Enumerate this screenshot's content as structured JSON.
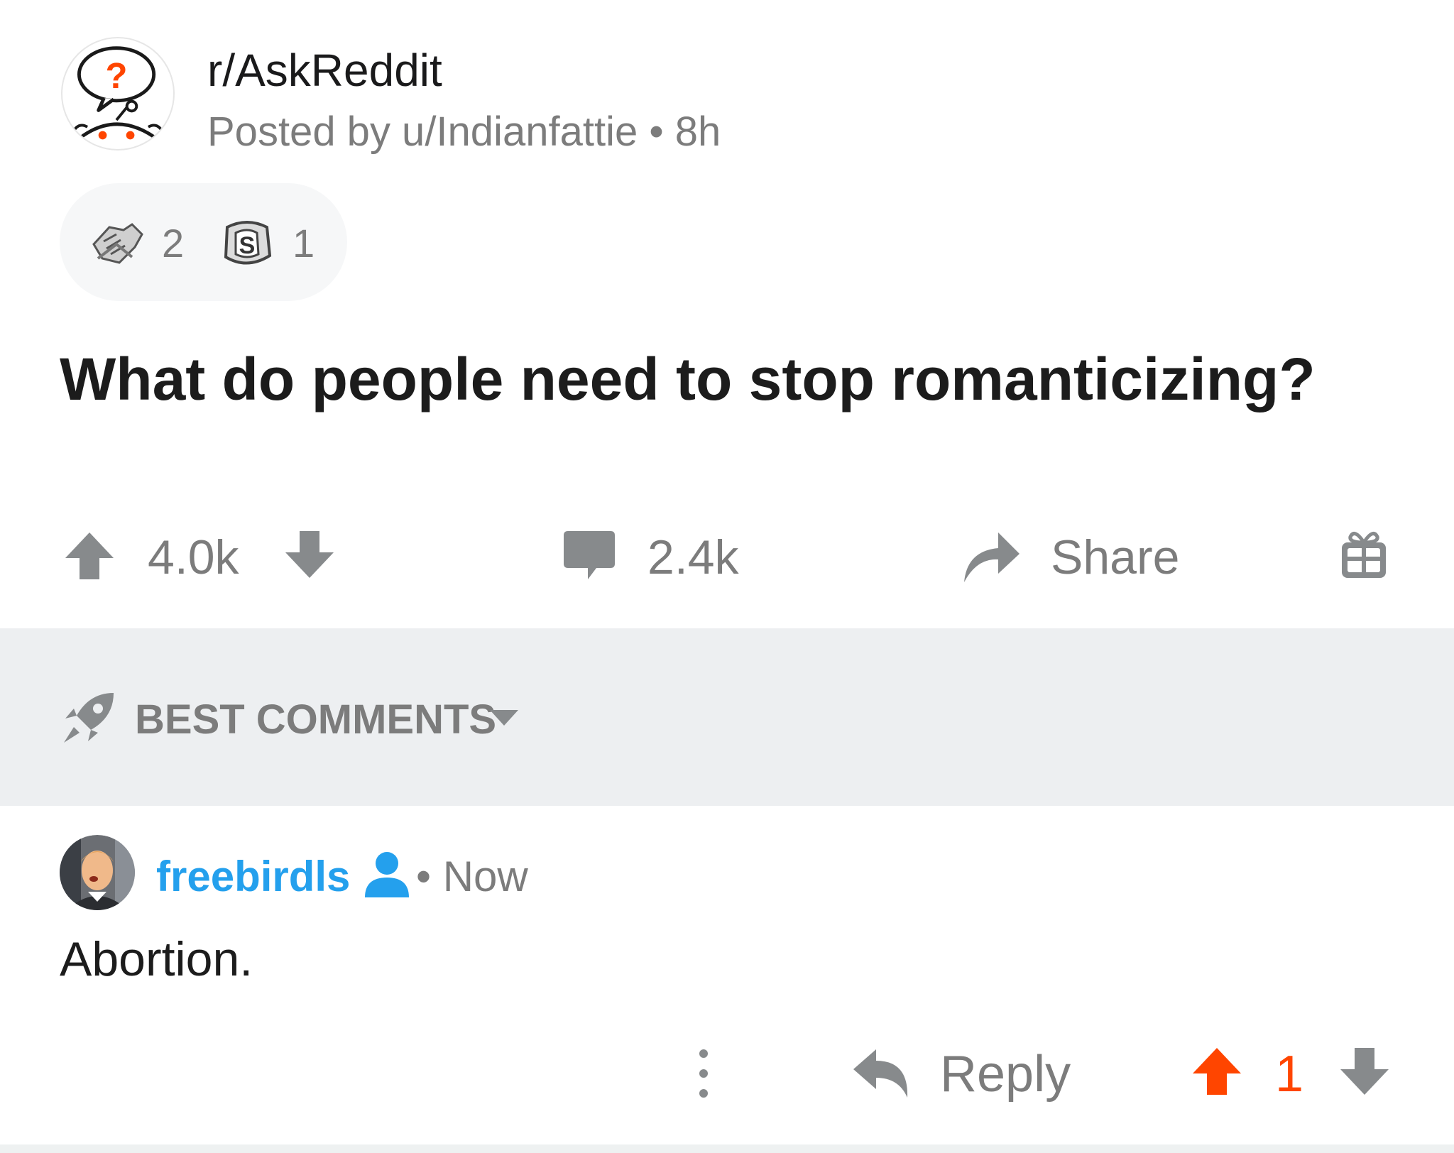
{
  "header": {
    "subreddit": "r/AskReddit",
    "posted_by": "Posted by u/Indianfattie",
    "separator": "•",
    "age": "8h"
  },
  "awards": [
    {
      "icon": "hands-together-award-icon",
      "count": "2"
    },
    {
      "icon": "silver-s-award-icon",
      "count": "1"
    }
  ],
  "post": {
    "title": "What do people need to stop romanticizing?",
    "votes": "4.0k",
    "comments": "2.4k",
    "share_label": "Share"
  },
  "sort": {
    "label": "BEST COMMENTS"
  },
  "comment": {
    "username": "freebirdls",
    "separator": "•",
    "time": "Now",
    "body": "Abortion.",
    "reply_label": "Reply",
    "score": "1"
  },
  "colors": {
    "accent_orange": "#ff4500",
    "username_blue": "#24a0ed",
    "meta_gray": "#7c7c7c",
    "sortbar_bg": "#edeff1"
  }
}
